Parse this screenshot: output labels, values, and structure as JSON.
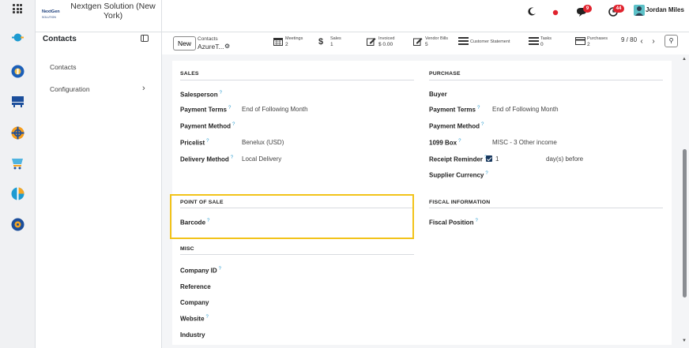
{
  "brand": {
    "logo_text_line1": "NextGen",
    "logo_text_line2": "SOLUTION",
    "company_name": "Nextgen Solution (New York)"
  },
  "topbar": {
    "message_badge": "9",
    "activity_badge": "44",
    "user_name": "Jordan Miles"
  },
  "sidebar": {
    "title": "Contacts",
    "items": [
      {
        "label": "Contacts"
      },
      {
        "label": "Configuration"
      }
    ]
  },
  "control_panel": {
    "new_label": "New",
    "breadcrumb_parent": "Contacts",
    "breadcrumb_current": "AzureT...",
    "stats": [
      {
        "label": "Meetings",
        "value": "2",
        "icon": "calendar-icon"
      },
      {
        "label": "Sales",
        "value": "1",
        "icon": "dollar-icon"
      },
      {
        "label": "Invoiced",
        "value": "$ 0.00",
        "icon": "pencil-square-icon"
      },
      {
        "label": "Vendor Bills",
        "value": "5",
        "icon": "pencil-square-icon"
      },
      {
        "label": "Customer Statement",
        "value": "",
        "icon": "list-icon"
      },
      {
        "label": "Tasks",
        "value": "0",
        "icon": "list-icon"
      },
      {
        "label": "Purchases",
        "value": "2",
        "icon": "credit-card-icon"
      }
    ],
    "pager": "9 / 80"
  },
  "form": {
    "sales": {
      "title": "SALES",
      "salesperson_label": "Salesperson",
      "payment_terms_label": "Payment Terms",
      "payment_terms_value": "End of Following Month",
      "payment_method_label": "Payment Method",
      "pricelist_label": "Pricelist",
      "pricelist_value": "Benelux (USD)",
      "delivery_method_label": "Delivery Method",
      "delivery_method_value": "Local Delivery"
    },
    "purchase": {
      "title": "PURCHASE",
      "buyer_label": "Buyer",
      "payment_terms_label": "Payment Terms",
      "payment_terms_value": "End of Following Month",
      "payment_method_label": "Payment Method",
      "box_1099_label": "1099 Box",
      "box_1099_value": "MISC - 3 Other income",
      "receipt_reminder_label": "Receipt Reminder",
      "receipt_reminder_value": "1",
      "receipt_reminder_suffix": "day(s) before",
      "supplier_currency_label": "Supplier Currency"
    },
    "pos": {
      "title": "POINT OF SALE",
      "barcode_label": "Barcode"
    },
    "fiscal": {
      "title": "FISCAL INFORMATION",
      "fiscal_position_label": "Fiscal Position"
    },
    "misc": {
      "title": "MISC",
      "company_id_label": "Company ID",
      "reference_label": "Reference",
      "company_label": "Company",
      "website_label": "Website",
      "industry_label": "Industry"
    }
  },
  "colors": {
    "accent_highlight": "#f2c31a",
    "help_mark": "#2f9fd0",
    "checkbox": "#17375e"
  }
}
